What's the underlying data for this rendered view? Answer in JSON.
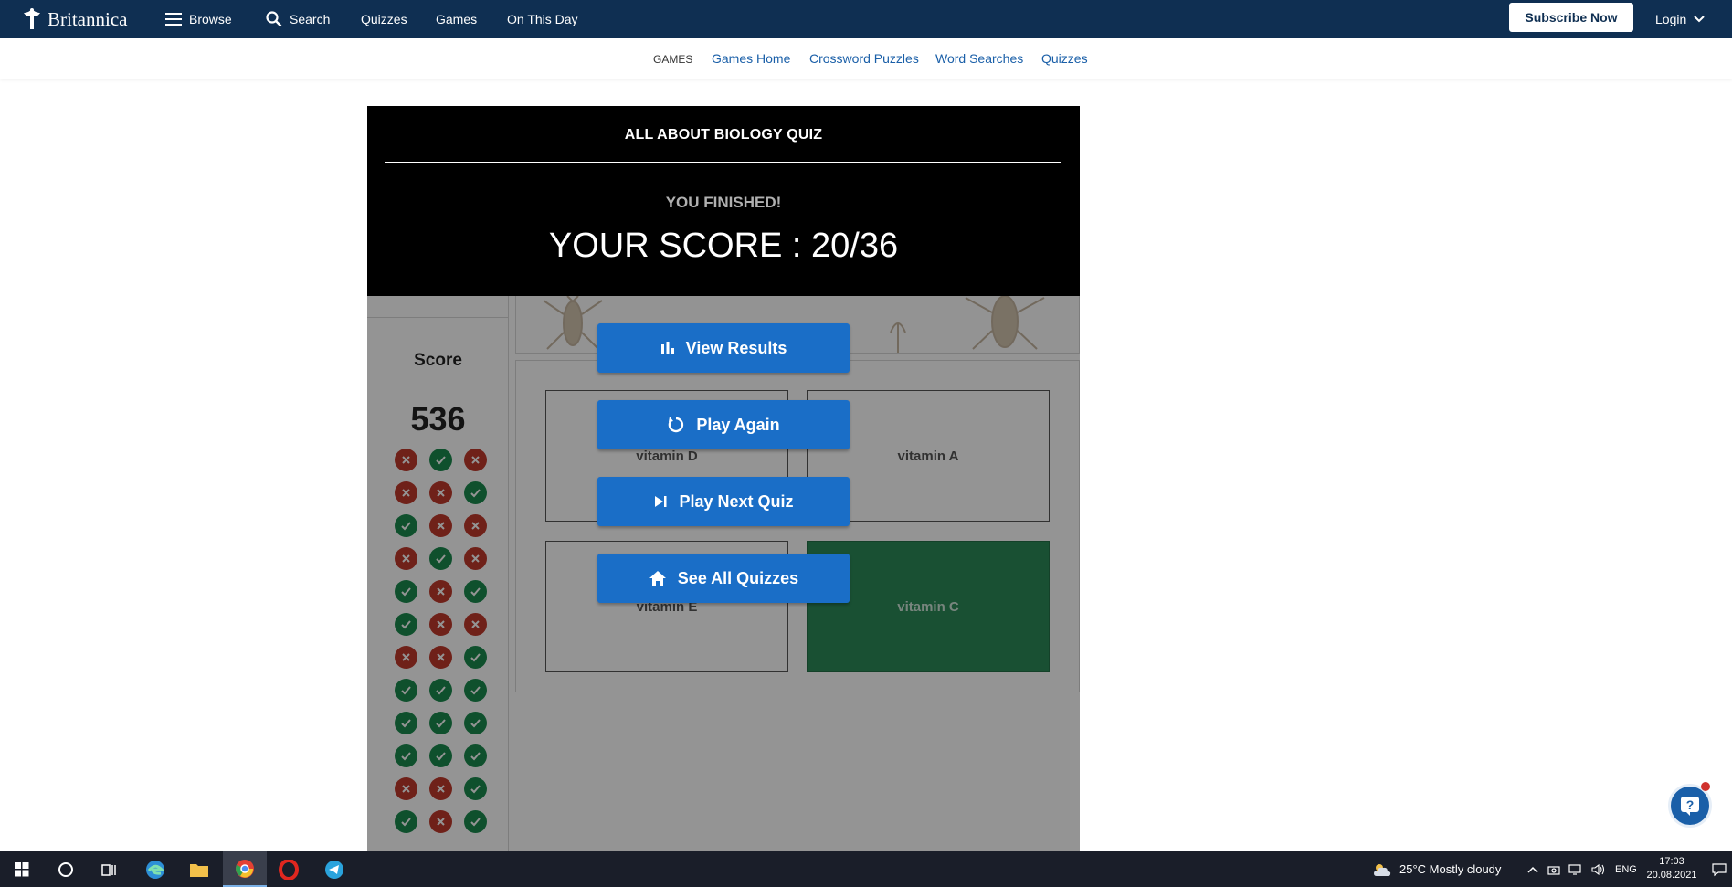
{
  "header": {
    "logo_text": "Britannica",
    "nav": {
      "browse": "Browse",
      "search": "Search",
      "quizzes": "Quizzes",
      "games": "Games",
      "on_this_day": "On This Day"
    },
    "subscribe": "Subscribe Now",
    "login": "Login",
    "brand_color": "#0f2f52"
  },
  "subnav": {
    "section": "GAMES",
    "items": [
      "Games Home",
      "Crossword Puzzles",
      "Word Searches",
      "Quizzes"
    ]
  },
  "quiz": {
    "title": "ALL ABOUT BIOLOGY QUIZ",
    "finished": "YOU FINISHED!",
    "score_line": "YOUR SCORE : 20/36",
    "score_label": "Score",
    "score_value": "536",
    "answers": [
      [
        "wrong",
        "right",
        "wrong"
      ],
      [
        "wrong",
        "wrong",
        "right"
      ],
      [
        "right",
        "wrong",
        "wrong"
      ],
      [
        "wrong",
        "right",
        "wrong"
      ],
      [
        "right",
        "wrong",
        "right"
      ],
      [
        "right",
        "wrong",
        "wrong"
      ],
      [
        "wrong",
        "wrong",
        "right"
      ],
      [
        "right",
        "right",
        "right"
      ],
      [
        "right",
        "right",
        "right"
      ],
      [
        "right",
        "right",
        "right"
      ],
      [
        "wrong",
        "wrong",
        "right"
      ],
      [
        "right",
        "wrong",
        "right"
      ]
    ],
    "options": {
      "a": "vitamin D",
      "b": "vitamin A",
      "c": "vitamin E",
      "d": "vitamin C"
    },
    "actions": {
      "view_results": "View Results",
      "play_again": "Play Again",
      "play_next": "Play Next Quiz",
      "see_all": "See All Quizzes"
    }
  },
  "taskbar": {
    "weather": "25°C  Mostly cloudy",
    "language": "ENG",
    "time": "17:03",
    "date": "20.08.2021"
  }
}
